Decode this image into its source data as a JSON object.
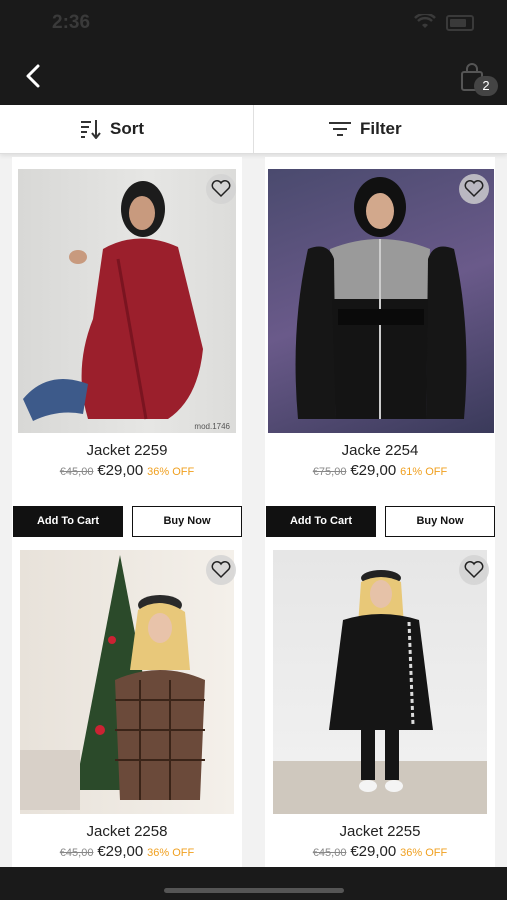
{
  "status_bar": {
    "time": "2:36"
  },
  "header": {
    "cart_count": "2"
  },
  "toolbar": {
    "sort_label": "Sort",
    "filter_label": "Filter"
  },
  "colors": {
    "accent_off": "#f0a020",
    "dark_bar": "#1a1a1a"
  },
  "products": [
    {
      "name": "Jacket 2259",
      "old_price": "€45,00",
      "price": "€29,00",
      "discount": "36% OFF",
      "photo_caption": "mod.1746",
      "add_to_cart": "Add To Cart",
      "buy_now": "Buy Now"
    },
    {
      "name": "Jacke 2254",
      "old_price": "€75,00",
      "price": "€29,00",
      "discount": "61% OFF",
      "add_to_cart": "Add To Cart",
      "buy_now": "Buy Now"
    },
    {
      "name": "Jacket 2258",
      "old_price": "€45,00",
      "price": "€29,00",
      "discount": "36% OFF"
    },
    {
      "name": "Jacket 2255",
      "old_price": "€45,00",
      "price": "€29,00",
      "discount": "36% OFF"
    }
  ]
}
